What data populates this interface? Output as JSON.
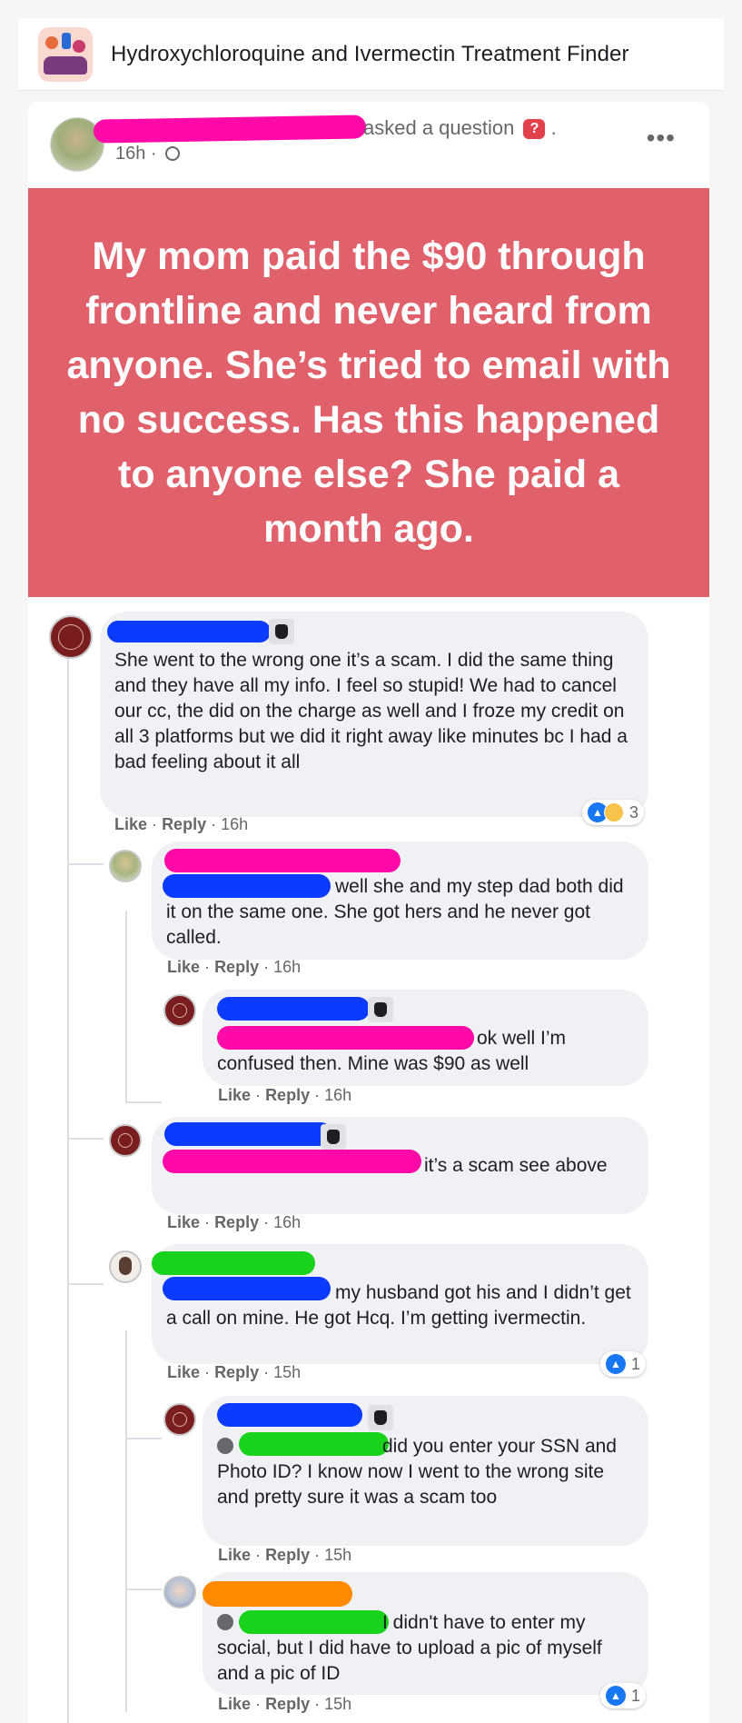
{
  "group": {
    "title": "Hydroxychloroquine and Ivermectin Treatment Finder",
    "icon": "group-icon"
  },
  "post": {
    "meta_text": "asked a question",
    "time": "16h ·",
    "more": "•••",
    "body": "My mom paid the $90 through frontline and never heard from anyone. She’s tried to email with no success. Has this happened to anyone else? She paid a month ago.",
    "banner_color": "#e0606c"
  },
  "comments": [
    {
      "text": "She went to the wrong one it’s a scam. I did the same thing and they have all my info. I feel so stupid! We had to cancel our cc, the did on the charge as well and I froze my credit on all 3 platforms but we did it right away like minutes bc I had a bad feeling about it all",
      "time": "16h",
      "reactions": "3"
    },
    {
      "text": "well she and my step dad both did it on the same one. She got hers and he never got called.",
      "time": "16h"
    },
    {
      "text": "ok well I’m confused then. Mine was $90 as well",
      "time": "16h"
    },
    {
      "text": "it’s a scam see above",
      "time": "16h"
    },
    {
      "text": "my husband got his and I didn’t get a call on mine. He got Hcq. I’m getting ivermectin.",
      "time": "15h",
      "reactions": "1"
    },
    {
      "text": "did you enter your SSN and Photo ID? I know now I went to the wrong site and pretty sure it was a scam too",
      "time": "15h"
    },
    {
      "text": "I didn't have to enter my social, but I did have to upload a pic of myself and a pic of ID",
      "time": "15h",
      "reactions": "1"
    }
  ],
  "labels": {
    "like": "Like",
    "reply": "Reply",
    "sep": "·"
  },
  "colors": {
    "redact_pink": "#ff0aa8",
    "redact_blue": "#0b3bff",
    "redact_green": "#19d21c",
    "redact_orange": "#ff8a00"
  }
}
